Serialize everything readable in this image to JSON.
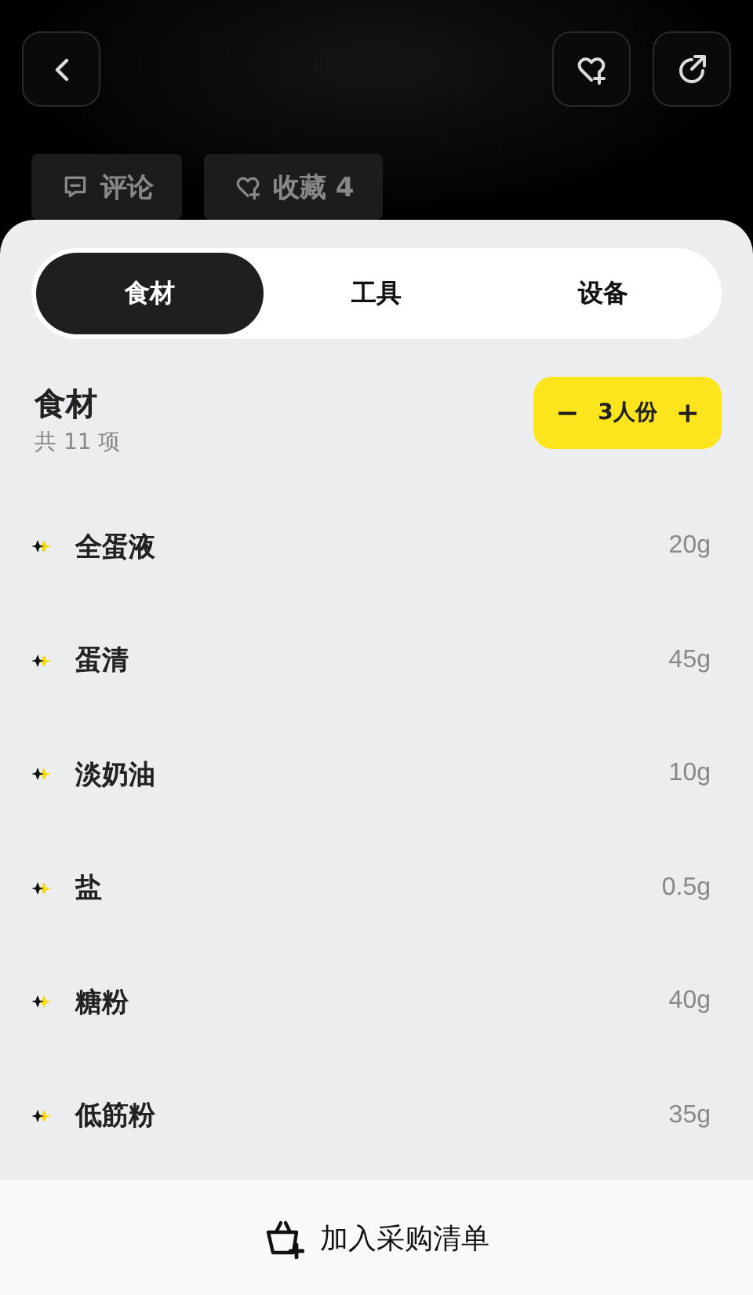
{
  "header": {
    "actions": [
      {
        "kind": "back"
      },
      {
        "kind": "favorite"
      },
      {
        "kind": "share"
      }
    ]
  },
  "chips": [
    {
      "kind": "comment",
      "label": "评论"
    },
    {
      "kind": "favorite",
      "label": "收藏 4"
    }
  ],
  "tabs": [
    {
      "label": "食材",
      "selected": true
    },
    {
      "label": "工具",
      "selected": false
    },
    {
      "label": "设备",
      "selected": false
    }
  ],
  "section": {
    "title": "食材",
    "count": "共 11 项"
  },
  "servings": {
    "minus": "−",
    "label": "3人份",
    "plus": "+"
  },
  "ingredients": [
    {
      "name": "全蛋液",
      "amount": "20g"
    },
    {
      "name": "蛋清",
      "amount": "45g"
    },
    {
      "name": "淡奶油",
      "amount": "10g"
    },
    {
      "name": "盐",
      "amount": "0.5g"
    },
    {
      "name": "糖粉",
      "amount": "40g"
    },
    {
      "name": "低筋粉",
      "amount": "35g"
    }
  ],
  "bottom_button": {
    "label": "加入采购清单"
  }
}
